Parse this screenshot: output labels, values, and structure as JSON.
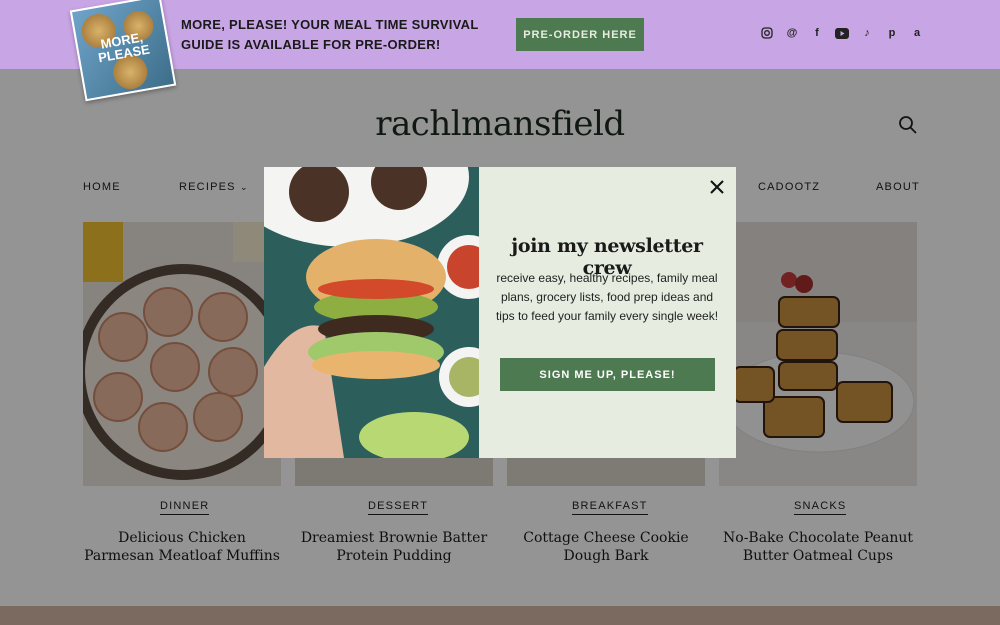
{
  "promo": {
    "book_title": "MORE, PLEASE",
    "text": "MORE, PLEASE! YOUR MEAL TIME SURVIVAL GUIDE IS AVAILABLE FOR PRE-ORDER!",
    "button": "PRE-ORDER HERE",
    "socials": [
      "instagram-icon",
      "threads-icon",
      "facebook-icon",
      "youtube-icon",
      "tiktok-icon",
      "pinterest-icon",
      "amazon-icon"
    ]
  },
  "header": {
    "logo": "rachlmansfield"
  },
  "nav": {
    "items": [
      "HOME",
      "RECIPES",
      "CADOOTZ",
      "ABOUT"
    ]
  },
  "cards": [
    {
      "category": "DINNER",
      "title": "Delicious Chicken Parmesan Meatloaf Muffins"
    },
    {
      "category": "DESSERT",
      "title": "Dreamiest Brownie Batter Protein Pudding"
    },
    {
      "category": "BREAKFAST",
      "title": "Cottage Cheese Cookie Dough Bark"
    },
    {
      "category": "SNACKS",
      "title": "No-Bake Chocolate Peanut Butter Oatmeal Cups"
    }
  ],
  "modal": {
    "heading": "join my newsletter crew",
    "body": "receive easy, healthy recipes, family meal plans, grocery lists, food prep ideas and tips to feed your family every single week!",
    "button": "SIGN ME UP, PLEASE!"
  },
  "colors": {
    "promo_bg": "#c8a5e4",
    "button_green": "#4e7a51",
    "modal_bg": "#e6ecdf",
    "footer_band": "#d3b7a6"
  }
}
